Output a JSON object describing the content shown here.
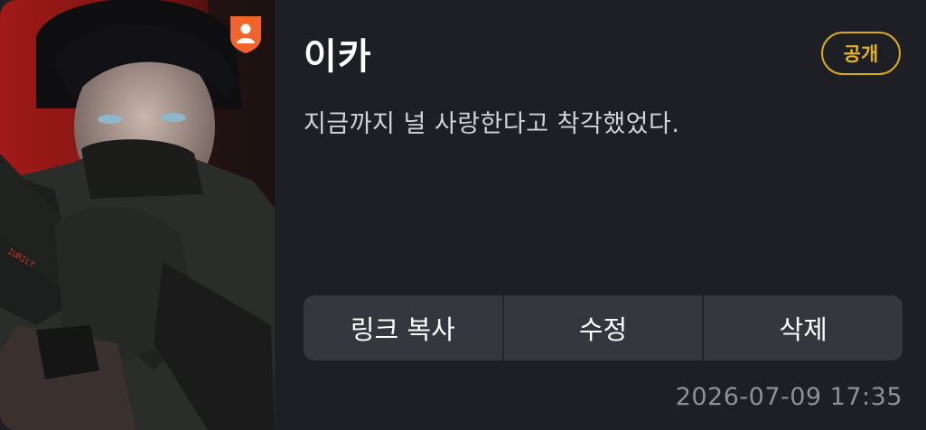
{
  "post": {
    "title": "이카",
    "visibility": "공개",
    "description": "지금까지 널 사랑한다고 착각했었다.",
    "timestamp": "2026-07-09 17:35",
    "thumbnail_badge_icon": "user-shield-icon"
  },
  "actions": {
    "copy_link": "링크 복사",
    "edit": "수정",
    "delete": "삭제"
  },
  "colors": {
    "background": "#1e1f24",
    "action_bar": "#35373e",
    "accent": "#d9a926",
    "badge": "#f0642e"
  }
}
